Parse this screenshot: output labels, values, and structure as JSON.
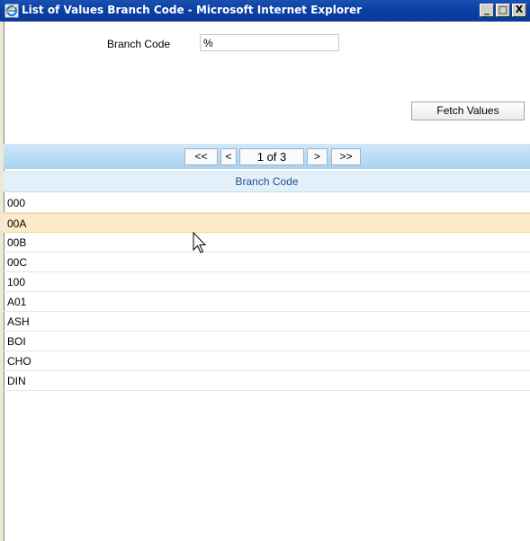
{
  "window": {
    "title": "List of Values Branch Code - Microsoft Internet Explorer",
    "controls": {
      "minimize": "_",
      "maximize": "□",
      "close": "X"
    }
  },
  "form": {
    "branch_code_label": "Branch Code",
    "branch_code_value": "%",
    "fetch_button": "Fetch Values"
  },
  "pager": {
    "first": "<<",
    "prev": "<",
    "page": "1 of 3",
    "next": ">",
    "last": ">>"
  },
  "table": {
    "column_header": "Branch Code",
    "rows": [
      "000",
      "00A",
      "00B",
      "00C",
      "100",
      "A01",
      "ASH",
      "BOI",
      "CHO",
      "DIN"
    ],
    "selected_index": 1
  },
  "colors": {
    "titlebar": "#0a3fa6",
    "pager_bar": "#a9d3f1",
    "header_text": "#1f4f8f",
    "selected_row": "#fcebc6"
  }
}
